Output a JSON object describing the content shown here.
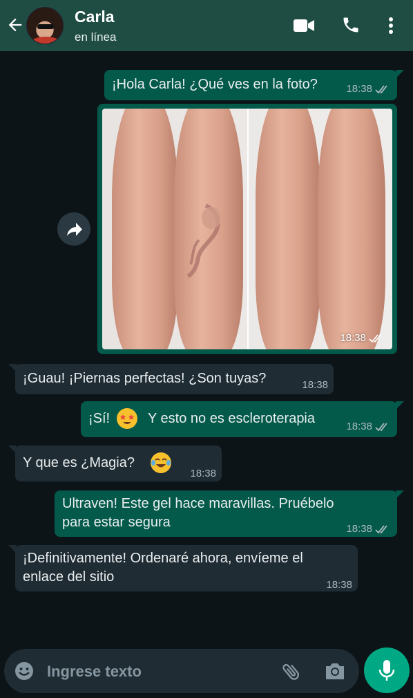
{
  "header": {
    "contact_name": "Carla",
    "status": "en línea",
    "icons": [
      "back-arrow-icon",
      "video-call-icon",
      "phone-icon",
      "more-options-icon"
    ],
    "bg_color": "#1f4d43"
  },
  "messages": [
    {
      "direction": "out",
      "text": "¡Hola Carla! ¿Qué ves en la foto?",
      "time": "18:38",
      "read": true
    },
    {
      "direction": "out",
      "type": "image",
      "image_alt": "Comparación de piernas antes y después",
      "time": "18:38",
      "read": true
    },
    {
      "direction": "in",
      "text": "¡Guau! ¡Piernas perfectas! ¿Son tuyas?",
      "time": "18:38"
    },
    {
      "direction": "out",
      "text_before": "¡Sí!",
      "emoji": "star-struck-emoji",
      "text_after": "Y esto no es escleroterapia",
      "time": "18:38",
      "read": true
    },
    {
      "direction": "in",
      "text": "Y que es ¿Magia?",
      "emoji": "tears-of-joy-emoji",
      "time": "18:38"
    },
    {
      "direction": "out",
      "lines": [
        "Ultraven! Este gel hace maravillas. Pruébelo",
        "para estar segura"
      ],
      "time": "18:38",
      "read": true
    },
    {
      "direction": "in",
      "lines": [
        "¡Definitivamente! Ordenaré ahora, envíeme el",
        "enlace del sitio"
      ],
      "time": "18:38"
    }
  ],
  "input": {
    "placeholder": "Ingrese texto",
    "icons": [
      "emoji-icon",
      "attach-icon",
      "camera-icon",
      "microphone-icon"
    ]
  },
  "colors": {
    "chat_bg": "#0d1418",
    "outgoing_bubble": "#035a4a",
    "incoming_bubble": "#1f2c34",
    "accent": "#00a884",
    "read_ticks": "#aebac1"
  }
}
